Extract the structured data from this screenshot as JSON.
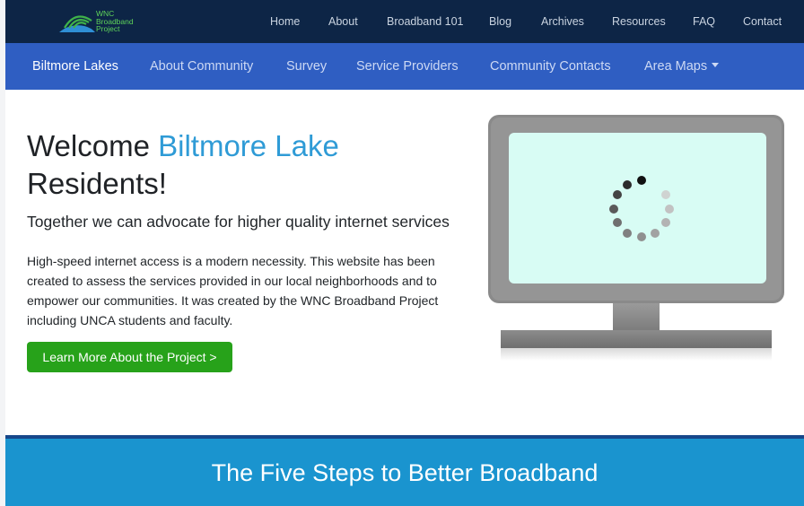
{
  "brand": {
    "logo_lines": [
      "WNC",
      "Broadband",
      "Project"
    ]
  },
  "top_nav": [
    "Home",
    "About",
    "Broadband 101",
    "Blog",
    "Archives",
    "Resources",
    "FAQ",
    "Contact"
  ],
  "sub_nav": {
    "items": [
      "Biltmore Lakes",
      "About Community",
      "Survey",
      "Service Providers",
      "Community Contacts",
      "Area Maps"
    ],
    "active": "Biltmore Lakes"
  },
  "hero": {
    "title_prefix": "Welcome ",
    "title_accent": "Biltmore Lake",
    "title_suffix": "Residents!",
    "subtitle": "Together we can advocate for higher quality internet services",
    "body": "High-speed internet access is a modern necessity. This website has been created to assess the services provided in our local neighborhoods and to empower our communities. It was created by the WNC Broadband Project including UNCA students and faculty.",
    "cta_label": "Learn More About the Project >"
  },
  "steps_section": {
    "title": "The Five Steps to Better Broadband"
  },
  "colors": {
    "top_bar": "#0d2546",
    "sub_nav": "#2f5ec2",
    "accent": "#2f9bd6",
    "cta": "#27a21a",
    "band": "#1a94cf",
    "logo_green": "#5fd35a"
  },
  "icons": [
    "wifi-logo-icon",
    "monitor-illustration",
    "loading-spinner-icon",
    "caret-down-icon"
  ]
}
